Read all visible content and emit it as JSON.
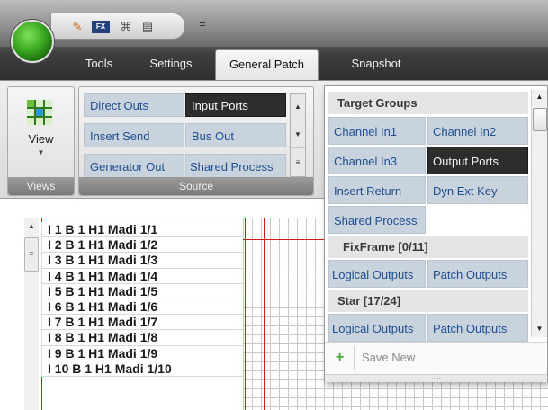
{
  "qat": {
    "dropdown_glyph": "=",
    "icons": [
      "tools-icon",
      "fx-icon",
      "binoculars-icon",
      "clipboard-icon"
    ],
    "fx_label": "FX"
  },
  "tabs": [
    {
      "label": "Tools",
      "active": false
    },
    {
      "label": "Settings",
      "active": false
    },
    {
      "label": "General Patch",
      "active": true
    },
    {
      "label": "Snapshot",
      "active": false
    }
  ],
  "ribbon": {
    "views_group_label": "Views",
    "view_button_label": "View",
    "source_group_label": "Source",
    "source_items": [
      {
        "label": "Direct Outs",
        "selected": false
      },
      {
        "label": "Input Ports",
        "selected": true
      },
      {
        "label": "Insert Send",
        "selected": false
      },
      {
        "label": "Bus Out",
        "selected": false
      },
      {
        "label": "Generator Out",
        "selected": false
      },
      {
        "label": "Shared Process",
        "selected": false
      }
    ]
  },
  "ports": [
    "I  1 B 1 H1 Madi 1/1",
    "I  2 B 1 H1 Madi 1/2",
    "I  3 B 1 H1 Madi 1/3",
    "I  4 B 1 H1 Madi 1/4",
    "I  5 B 1 H1 Madi 1/5",
    "I  6 B 1 H1 Madi 1/6",
    "I  7 B 1 H1 Madi 1/7",
    "I  8 B 1 H1 Madi 1/8",
    "I  9 B 1 H1 Madi 1/9",
    "I 10 B 1 H1 Madi 1/10"
  ],
  "target_popup": {
    "headers": [
      "Target Groups",
      "FixFrame [0/11]",
      "Star [17/24]"
    ],
    "target_groups": [
      {
        "label": "Channel In1",
        "selected": false
      },
      {
        "label": "Channel In2",
        "selected": false
      },
      {
        "label": "Channel In3",
        "selected": false
      },
      {
        "label": "Output Ports",
        "selected": true
      },
      {
        "label": "Insert Return",
        "selected": false
      },
      {
        "label": "Dyn Ext Key",
        "selected": false
      },
      {
        "label": "Shared Process",
        "selected": false
      }
    ],
    "fixframe_items": [
      "Logical Outputs",
      "Patch Outputs"
    ],
    "star_items": [
      "Logical Outputs",
      "Patch Outputs"
    ],
    "save_new_label": "Save New",
    "grip_glyph": "....."
  },
  "colors": {
    "selection_dark": "#2d2d2d",
    "cell_blue_bg": "#c9d3de",
    "cell_text_blue": "#1e4f8e",
    "patch_line_red": "#d11a1a",
    "orb_green": "#3aa822"
  }
}
